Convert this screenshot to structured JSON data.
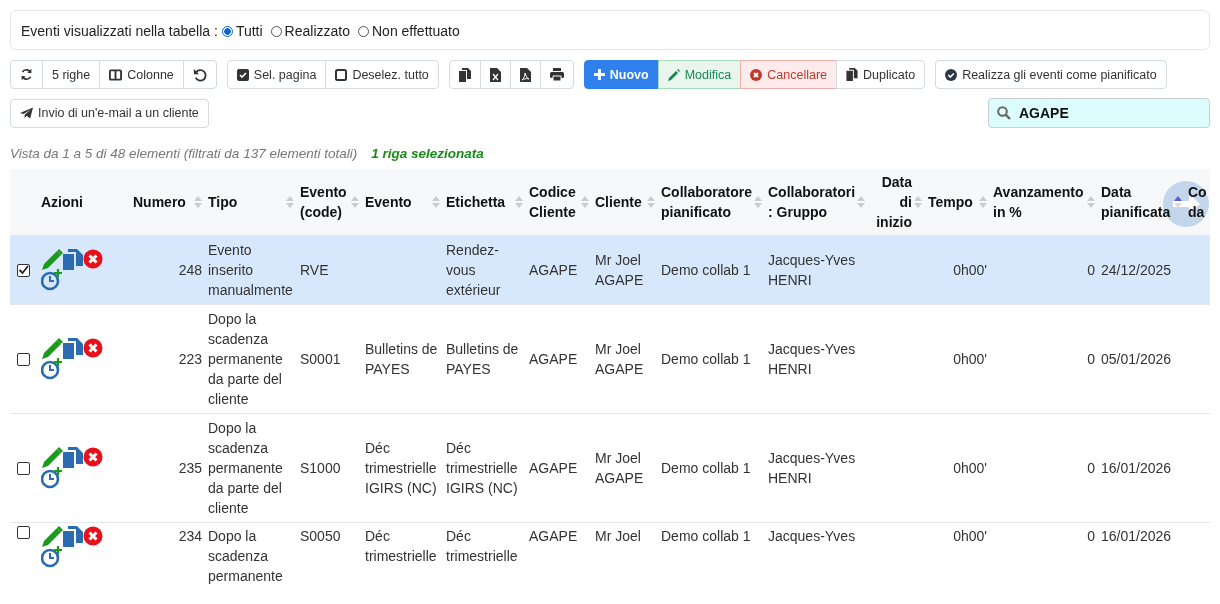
{
  "filter": {
    "label": "Eventi visualizzati nella tabella :",
    "options": [
      {
        "label": "Tutti",
        "selected": true
      },
      {
        "label": "Realizzato",
        "selected": false
      },
      {
        "label": "Non effettuato",
        "selected": false
      }
    ]
  },
  "toolbar": {
    "rows": [
      {
        "groups": [
          [
            {
              "kind": "refresh"
            },
            {
              "kind": "rows",
              "label": "5 righe"
            },
            {
              "kind": "columns",
              "label": "Colonne"
            },
            {
              "kind": "reset"
            }
          ],
          [
            {
              "kind": "select",
              "label": "Sel. pagina"
            },
            {
              "kind": "deselect",
              "label": "Deselez. tutto"
            }
          ],
          [
            {
              "kind": "copy"
            },
            {
              "kind": "excel"
            },
            {
              "kind": "pdf"
            },
            {
              "kind": "print"
            }
          ],
          [
            {
              "kind": "new",
              "label": "Nuovo"
            },
            {
              "kind": "edit",
              "label": "Modifica"
            },
            {
              "kind": "delete",
              "label": "Cancellare"
            },
            {
              "kind": "duplicate",
              "label": "Duplicato"
            }
          ],
          [
            {
              "kind": "realize",
              "label": "Realizza gli eventi come pianificato"
            }
          ]
        ]
      },
      {
        "groups": [
          [
            {
              "kind": "email",
              "label": "Invio di un'e-mail a un cliente"
            }
          ]
        ]
      }
    ]
  },
  "search": {
    "value": "AGAPE"
  },
  "info": {
    "summary": "Vista da 1 a 5 di 48 elementi (filtrati da 137 elementi totali)",
    "selection": "1 riga selezionata"
  },
  "table": {
    "columns": [
      {
        "label": "Azioni",
        "sortable": false,
        "sorted": false
      },
      {
        "label": "Numero",
        "sortable": true,
        "sorted": false
      },
      {
        "label": "Tipo",
        "sortable": true,
        "sorted": false
      },
      {
        "label": "Evento (code)",
        "sortable": true,
        "sorted": false
      },
      {
        "label": "Evento",
        "sortable": true,
        "sorted": false
      },
      {
        "label": "Etichetta",
        "sortable": true,
        "sorted": false
      },
      {
        "label": "Codice Cliente",
        "sortable": true,
        "sorted": false
      },
      {
        "label": "Cliente",
        "sortable": true,
        "sorted": false
      },
      {
        "label": "Collaboratore pianificato",
        "sortable": true,
        "sorted": false
      },
      {
        "label": "Collaboratori : Gruppo",
        "sortable": true,
        "sorted": false
      },
      {
        "label": "Data di inizio",
        "sortable": true,
        "sorted": false
      },
      {
        "label": "Tempo",
        "sortable": true,
        "sorted": false
      },
      {
        "label": "Avanzamento in %",
        "sortable": true,
        "sorted": false
      },
      {
        "label": "Data pianificata",
        "sortable": true,
        "sorted": true
      },
      {
        "label": "Co da"
      }
    ],
    "rows": [
      {
        "selected": true,
        "numero": "248",
        "tipo": "Evento inserito manualmente",
        "evento_code": "RVE",
        "etichetta": "Rendez-vous extérieur",
        "codice_cliente": "AGAPE",
        "cliente": "Mr Joel AGAPE",
        "collaboratore": "Demo collab 1",
        "gruppo": "Jacques-Yves HENRI",
        "tempo": "0h00'",
        "avanzamento": "0",
        "data_pianificata": "24/12/2025"
      },
      {
        "selected": false,
        "numero": "223",
        "tipo": "Dopo la scadenza permanente da parte del cliente",
        "evento_code": "S0001",
        "evento": "Bulletins de PAYES",
        "etichetta": "Bulletins de PAYES",
        "codice_cliente": "AGAPE",
        "cliente": "Mr Joel AGAPE",
        "collaboratore": "Demo collab 1",
        "gruppo": "Jacques-Yves HENRI",
        "tempo": "0h00'",
        "avanzamento": "0",
        "data_pianificata": "05/01/2026"
      },
      {
        "selected": false,
        "numero": "235",
        "tipo": "Dopo la scadenza permanente da parte del cliente",
        "evento_code": "S1000",
        "evento": "Déc trimestrielle IGIRS (NC)",
        "etichetta": "Déc trimestrielle IGIRS (NC)",
        "codice_cliente": "AGAPE",
        "cliente": "Mr Joel AGAPE",
        "collaboratore": "Demo collab 1",
        "gruppo": "Jacques-Yves HENRI",
        "tempo": "0h00'",
        "avanzamento": "0",
        "data_pianificata": "16/01/2026"
      },
      {
        "selected": false,
        "numero": "234",
        "tipo": "Dopo la scadenza permanente",
        "evento_code": "S0050",
        "evento": "Déc trimestrielle",
        "etichetta": "Déc trimestrielle",
        "codice_cliente": "AGAPE",
        "cliente": "Mr Joel",
        "collaboratore": "Demo collab 1",
        "gruppo": "Jacques-Yves",
        "tempo": "0h00'",
        "avanzamento": "0",
        "data_pianificata": "16/01/2026"
      }
    ]
  }
}
